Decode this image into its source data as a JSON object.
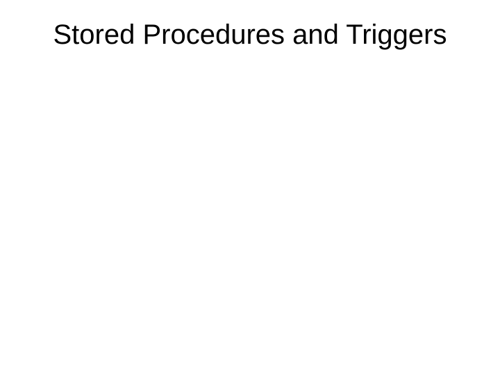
{
  "slide": {
    "title": "Stored Procedures and Triggers"
  }
}
